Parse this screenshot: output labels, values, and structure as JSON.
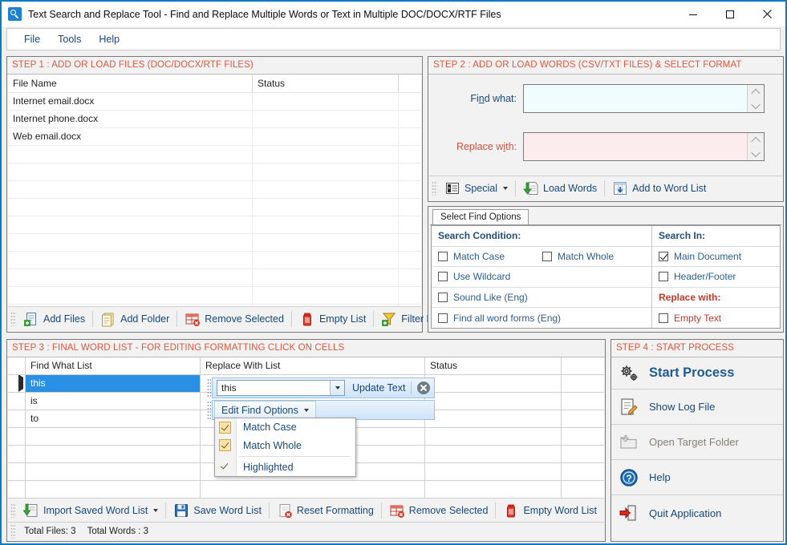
{
  "window": {
    "title": "Text Search and Replace Tool  - Find and Replace Multiple Words or Text  in Multiple DOC/DOCX/RTF Files",
    "app_icon": "magnifier-icon",
    "minimize": "—",
    "maximize": "□",
    "close": "✕",
    "accent_border": "#0d7bc4"
  },
  "menubar": {
    "items": [
      {
        "label": "File"
      },
      {
        "label": "Tools"
      },
      {
        "label": "Help"
      }
    ]
  },
  "step1": {
    "header": "STEP 1 : ADD OR LOAD FILES (DOC/DOCX/RTF FILES)",
    "header_color": "#e2553d",
    "columns": [
      "File Name",
      "Status",
      ""
    ],
    "rows": [
      {
        "name": "Internet email.docx",
        "status": ""
      },
      {
        "name": "Internet phone.docx",
        "status": ""
      },
      {
        "name": "Web email.docx",
        "status": ""
      }
    ],
    "empty_rows": 10,
    "toolbar": [
      {
        "label": "Add Files",
        "icon": "add-file-icon",
        "dropdown": false
      },
      {
        "label": "Add Folder",
        "icon": "add-folder-icon",
        "dropdown": false
      },
      {
        "label": "Remove Selected",
        "icon": "remove-row-icon",
        "dropdown": false
      },
      {
        "label": "Empty List",
        "icon": "trash-icon",
        "dropdown": false
      },
      {
        "label": "Filter List",
        "icon": "filter-icon",
        "dropdown": true
      }
    ]
  },
  "step2": {
    "header": "STEP 2 : ADD OR LOAD WORDS (CSV/TXT FILES) & SELECT FORMAT",
    "find_label_a": "Fi",
    "find_label_u": "n",
    "find_label_b": "d what:",
    "replace_label_a": "Replace w",
    "replace_label_u": "i",
    "replace_label_b": "th:",
    "find_value": "",
    "replace_value": "",
    "find_bg": "#f0fcfd",
    "replace_bg": "#fdeced",
    "toolbar": [
      {
        "label": "Special",
        "icon": "special-list-icon",
        "dropdown": true
      },
      {
        "label": "Load Words",
        "icon": "load-words-icon",
        "dropdown": false
      },
      {
        "label": "Add to Word List",
        "icon": "add-to-grid-icon",
        "dropdown": false
      }
    ]
  },
  "find_options": {
    "tab_label": "Select Find Options",
    "left_heading": "Search Condition:",
    "right_heading": "Search In:",
    "replace_heading": "Replace with:",
    "left_items": [
      {
        "label": "Match Case",
        "checked": false
      },
      {
        "label": "Match Whole",
        "checked": false
      },
      {
        "label": "Use Wildcard",
        "checked": false
      },
      {
        "label": "Sound Like (Eng)",
        "checked": false
      },
      {
        "label": "Find all word forms (Eng)",
        "checked": false
      }
    ],
    "right_items": [
      {
        "label": "Main Document",
        "checked": true
      },
      {
        "label": "Header/Footer",
        "checked": false
      },
      {
        "label": "Empty Text",
        "checked": false,
        "red": true
      }
    ]
  },
  "step3": {
    "header": "STEP 3 : FINAL WORD LIST - FOR EDITING FORMATTING CLICK ON CELLS",
    "columns": [
      "",
      "Find What List",
      "Replace With List",
      "Status",
      ""
    ],
    "rows": [
      {
        "find": "this",
        "replace": "",
        "status": "",
        "selected": true
      },
      {
        "find": "is",
        "replace": "",
        "status": "",
        "selected": false
      },
      {
        "find": "to",
        "replace": "",
        "status": "",
        "selected": false
      }
    ],
    "empty_rows": 5,
    "cell_editor": {
      "combo_value": "this",
      "update_label": "Update Text",
      "close_icon": "close-circle-icon",
      "options_button": "Edit Find Options"
    },
    "dropdown_menu": {
      "items": [
        {
          "label": "Match Case",
          "checked": true
        },
        {
          "label": "Match Whole",
          "checked": true
        },
        {
          "label": "Highlighted",
          "checked": false,
          "separator_before": true
        }
      ]
    },
    "toolbar": [
      {
        "label": "Import Saved Word List",
        "icon": "import-icon",
        "dropdown": true
      },
      {
        "label": "Save Word List",
        "icon": "save-icon",
        "dropdown": false
      },
      {
        "label": "Reset Formatting",
        "icon": "reset-format-icon",
        "dropdown": false
      },
      {
        "label": "Remove Selected",
        "icon": "remove-row-icon",
        "dropdown": false
      },
      {
        "label": "Empty Word List",
        "icon": "trash-icon",
        "dropdown": false
      }
    ],
    "status_total_files": "Total Files: 3",
    "status_total_words": "Total Words : 3"
  },
  "step4": {
    "header": "STEP 4 : START PROCESS",
    "items": [
      {
        "label": "Start Process",
        "icon": "gears-icon",
        "style": "big"
      },
      {
        "label": "Show Log File",
        "icon": "log-file-icon",
        "style": "normal"
      },
      {
        "label": "Open Target Folder",
        "icon": "open-folder-icon",
        "style": "disabled"
      },
      {
        "label": "Help",
        "icon": "help-circle-icon",
        "style": "normal"
      },
      {
        "label": "Quit Application",
        "icon": "exit-icon",
        "style": "normal"
      }
    ]
  }
}
